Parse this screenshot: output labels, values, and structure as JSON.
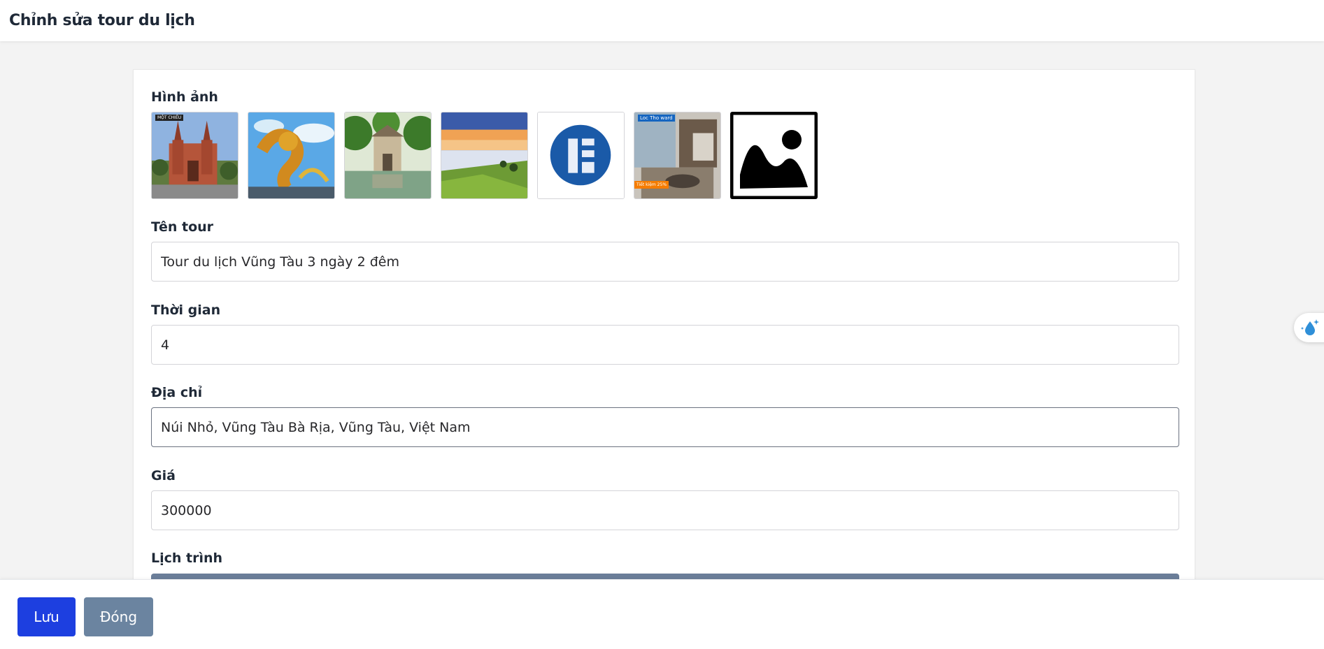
{
  "header": {
    "title": "Chỉnh sửa tour du lịch"
  },
  "form": {
    "images_label": "Hình ảnh",
    "images": [
      {
        "name": "cathedral",
        "tag": "MỘT CHIỀU"
      },
      {
        "name": "dragon-bridge"
      },
      {
        "name": "turtle-tower"
      },
      {
        "name": "valley-fog"
      },
      {
        "name": "blue-logo"
      },
      {
        "name": "hotel-room",
        "tag": "Loc Tho ward",
        "badge": "Tiết kiệm 25%"
      },
      {
        "name": "image-placeholder"
      }
    ],
    "tour_name": {
      "label": "Tên tour",
      "value": "Tour du lịch Vũng Tàu 3 ngày 2 đêm"
    },
    "duration": {
      "label": "Thời gian",
      "value": "4"
    },
    "address": {
      "label": "Địa chỉ",
      "value": "Núi Nhỏ, Vũng Tàu Bà Rịa, Vũng Tàu, Việt Nam"
    },
    "price": {
      "label": "Giá",
      "value": "300000"
    },
    "schedule": {
      "label": "Lịch trình"
    }
  },
  "footer": {
    "save_label": "Lưu",
    "close_label": "Đóng"
  },
  "colors": {
    "primary": "#1d3fe0",
    "secondary": "#6b84a0",
    "schedule_bar": "#6b7e99"
  },
  "widget": {
    "icon": "water-drop-sparkle-icon"
  }
}
